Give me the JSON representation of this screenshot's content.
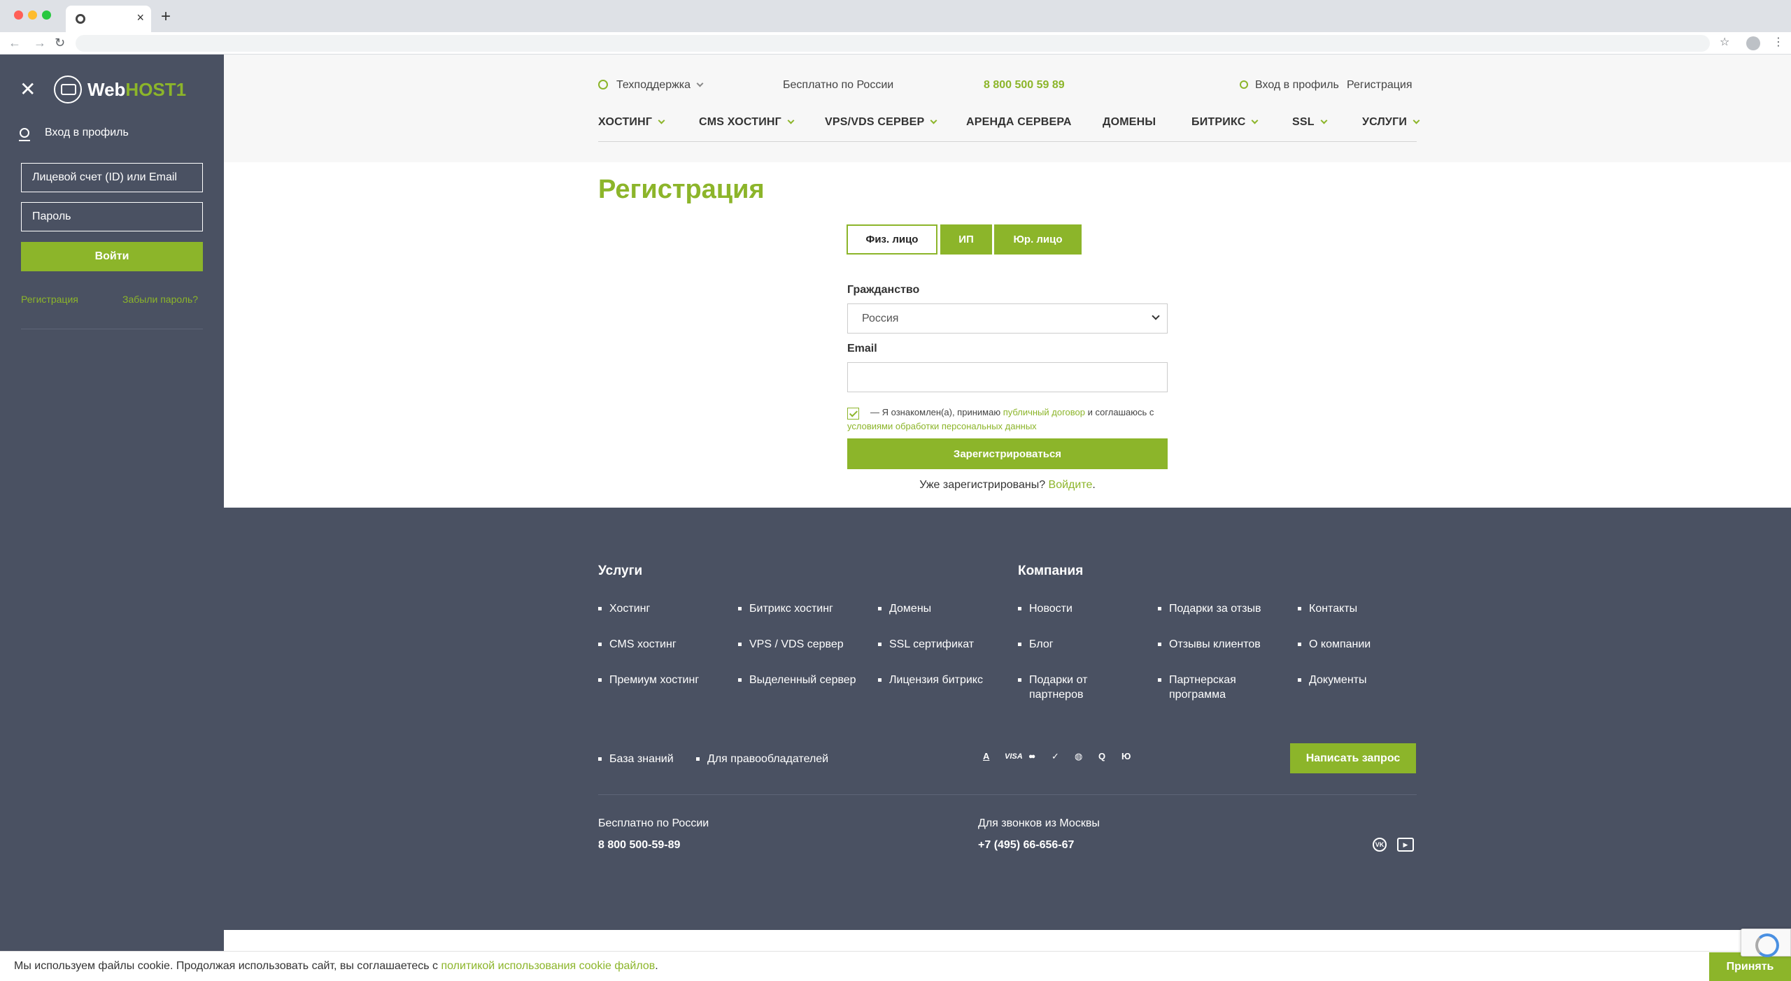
{
  "sidebar": {
    "close_glyph": "✕",
    "logo_web": "Web",
    "logo_host": "HOST1",
    "login_label": "Вход в профиль",
    "account_placeholder": "Лицевой счет (ID) или Email",
    "password_placeholder": "Пароль",
    "login_button": "Войти",
    "register_link": "Регистрация",
    "forgot_link": "Забыли пароль?"
  },
  "header": {
    "support": "Техподдержка",
    "free_label": "Бесплатно по России",
    "phone": "8 800 500 59 89",
    "login": "Вход в профиль",
    "register": "Регистрация",
    "menu": [
      "ХОСТИНГ",
      "CMS ХОСТИНГ",
      "VPS/VDS СЕРВЕР",
      "АРЕНДА СЕРВЕРА",
      "ДОМЕНЫ",
      "БИТРИКС",
      "SSL",
      "УСЛУГИ"
    ]
  },
  "main": {
    "title": "Регистрация",
    "type_tabs": [
      "Физ. лицо",
      "ИП",
      "Юр. лицо"
    ],
    "citizenship_label": "Гражданство",
    "citizenship_value": "Россия",
    "email_label": "Email",
    "agree_prefix": "— Я ознакомлен(а), принимаю ",
    "agree_link1": "публичный договор",
    "agree_mid": " и соглашаюсь с ",
    "agree_link2": "условиями обработки персональных данных",
    "register_button": "Зарегистрироваться",
    "already_text": "Уже зарегистрированы? ",
    "already_link": "Войдите",
    "already_dot": "."
  },
  "footer": {
    "services_heading": "Услуги",
    "company_heading": "Компания",
    "services": [
      "Хостинг",
      "Битрикс хостинг",
      "Домены",
      "CMS хостинг",
      "VPS / VDS сервер",
      "SSL сертификат",
      "Премиум хостинг",
      "Выделенный сервер",
      "Лицензия битрикс"
    ],
    "company": [
      "Новости",
      "Подарки за отзыв",
      "Контакты",
      "Блог",
      "Отзывы клиентов",
      "О компании",
      "Подарки от партнеров",
      "Партнерская программа",
      "Документы"
    ],
    "extra_links": [
      "База знаний",
      "Для правообладателей"
    ],
    "payment_icons": [
      "A",
      "VISA",
      "●●",
      "✓",
      "◍",
      "Q",
      "Ю"
    ],
    "write_button": "Написать запрос",
    "free_label": "Бесплатно по России",
    "free_phone": "8 800 500-59-89",
    "moscow_label": "Для звонков из Москвы",
    "moscow_phone": "+7 (495) 66-656-67",
    "social": [
      "VK",
      "▶"
    ]
  },
  "cookie": {
    "text": "Мы используем файлы cookie. Продолжая использовать сайт, вы соглашаетесь с ",
    "link": "политикой использования cookie файлов",
    "dot": ".",
    "accept": "Принять"
  },
  "colors": {
    "accent": "#8cb52a",
    "dark": "#4a5162"
  }
}
